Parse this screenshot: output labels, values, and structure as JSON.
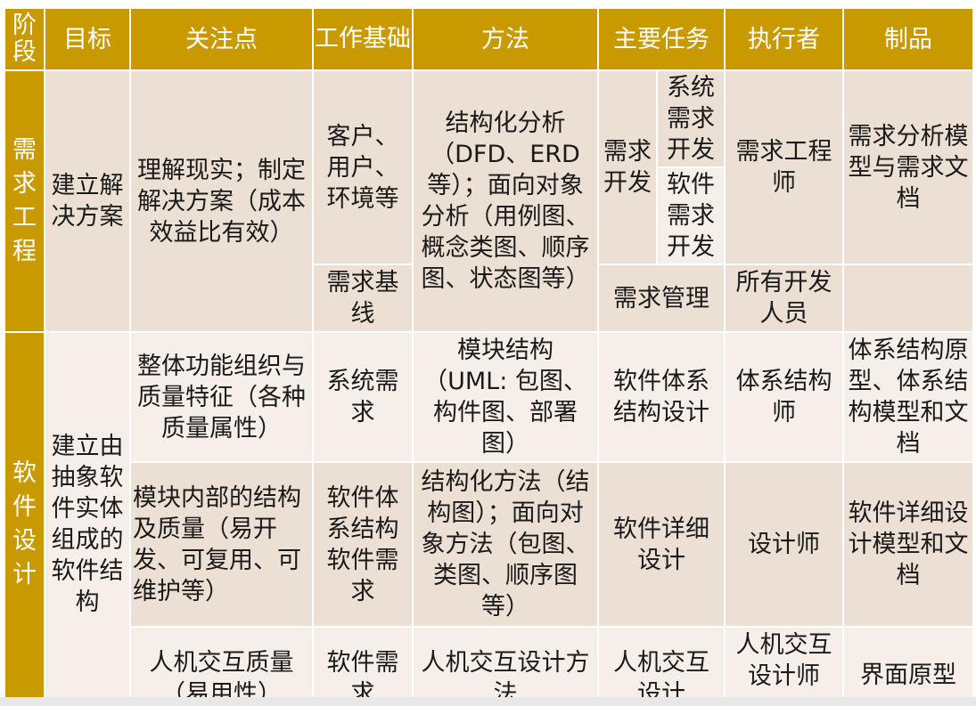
{
  "headers": [
    "阶段",
    "目标",
    "关注点",
    "工作基础",
    "方法",
    "主要任务",
    "执行者",
    "制品"
  ],
  "phases": {
    "requirements": "需求工程",
    "design": "软件设计"
  },
  "rows": {
    "r1": {
      "goal": "建立解决方案",
      "focus": "理解现实；制定解决方案（成本效益比有效）",
      "basis": "客户、用户、环境等",
      "method": "结构化分析（DFD、ERD等）；面向对象分析（用例图、概念类图、顺序图、状态图等）",
      "task_group": "需求开发",
      "task_a": "系统需求开发",
      "task_b": "软件需求开发",
      "executor": "需求工程师",
      "artifact": "需求分析模型与需求文档"
    },
    "r2": {
      "basis": "需求基线",
      "task": "需求管理",
      "executor": "所有开发人员",
      "artifact": ""
    },
    "r3": {
      "goal": "建立由抽象软件实体组成的软件结构",
      "focus": "整体功能组织与质量特征（各种质量属性）",
      "basis": "系统需求",
      "method": "模块结构（UML: 包图、构件图、部署图）",
      "task": "软件体系结构设计",
      "executor": "体系结构师",
      "artifact": "体系结构原型、体系结构模型和文档"
    },
    "r4": {
      "focus": "模块内部的结构及质量（易开发、可复用、可维护等）",
      "basis": "软件体系结构软件需求",
      "method": "结构化方法（结构图）；面向对象方法（包图、类图、顺序图等）",
      "task": "软件详细设计",
      "executor": "设计师",
      "artifact": "软件详细设计模型和文档"
    },
    "r5": {
      "focus": "人机交互质量（易用性）",
      "basis": "软件需求",
      "method": "人机交互设计方法",
      "task": "人机交互设计",
      "executor": "人机交互设计师",
      "artifact": "界面原型"
    }
  },
  "colors": {
    "header_bg": "#c89a00",
    "cell_dark": "#ecdfd3",
    "cell_light": "#f6efe9"
  }
}
